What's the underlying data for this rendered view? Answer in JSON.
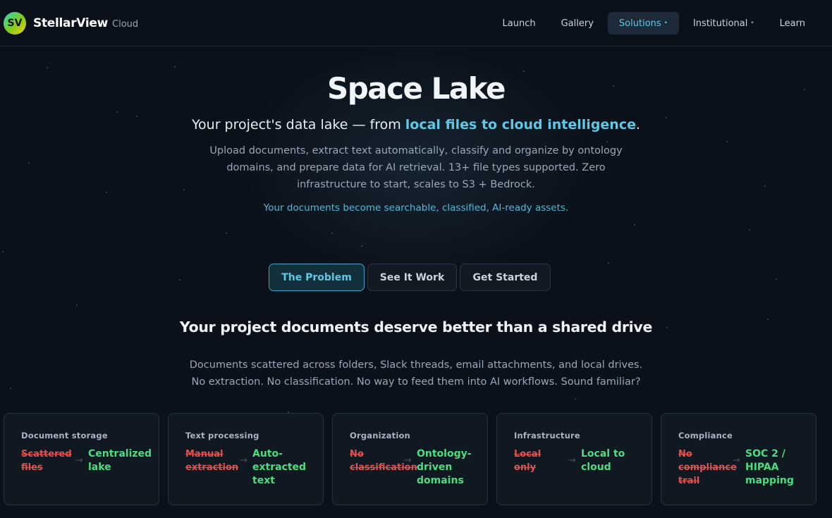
{
  "brand": {
    "initials": "SV",
    "name": "StellarView",
    "suffix": "Cloud"
  },
  "nav": [
    {
      "label": "Launch",
      "dropdown": false,
      "active": false
    },
    {
      "label": "Gallery",
      "dropdown": false,
      "active": false
    },
    {
      "label": "Solutions",
      "dropdown": true,
      "active": true
    },
    {
      "label": "Institutional",
      "dropdown": true,
      "active": false
    },
    {
      "label": "Learn",
      "dropdown": false,
      "active": false
    }
  ],
  "nav_dropdown_marker": "•",
  "hero": {
    "title": "Space Lake",
    "tagline_prefix": "Your project's data lake — from ",
    "tagline_highlight": "local files to cloud intelligence",
    "tagline_suffix": ".",
    "description": "Upload documents, extract text automatically, classify and organize by ontology domains, and prepare data for AI retrieval. 13+ file types supported. Zero infrastructure to start, scales to S3 + Bedrock.",
    "accent_line": "Your documents become searchable, classified, AI-ready assets."
  },
  "tabs": [
    {
      "label": "The Problem",
      "active": true
    },
    {
      "label": "See It Work",
      "active": false
    },
    {
      "label": "Get Started",
      "active": false
    }
  ],
  "section": {
    "title": "Your project documents deserve better than a shared drive",
    "desc_line1": "Documents scattered across folders, Slack threads, email attachments, and local drives.",
    "desc_line2": "No extraction. No classification. No way to feed them into AI workflows. Sound familiar?"
  },
  "cards": [
    {
      "title": "Document storage",
      "old": "Scattered files",
      "new": "Centralized lake"
    },
    {
      "title": "Text processing",
      "old": "Manual extraction",
      "new": "Auto-extracted text"
    },
    {
      "title": "Organization",
      "old": "No classification",
      "new": "Ontology-driven domains"
    },
    {
      "title": "Infrastructure",
      "old": "Local only",
      "new": "Local to cloud"
    },
    {
      "title": "Compliance",
      "old": "No compliance trail",
      "new": "SOC 2 / HIPAA mapping"
    }
  ],
  "arrow_glyph": "→",
  "colors": {
    "background": "#0b111a",
    "accent": "#5ec8e5",
    "struck": "#e0524f",
    "positive": "#4ade80"
  }
}
